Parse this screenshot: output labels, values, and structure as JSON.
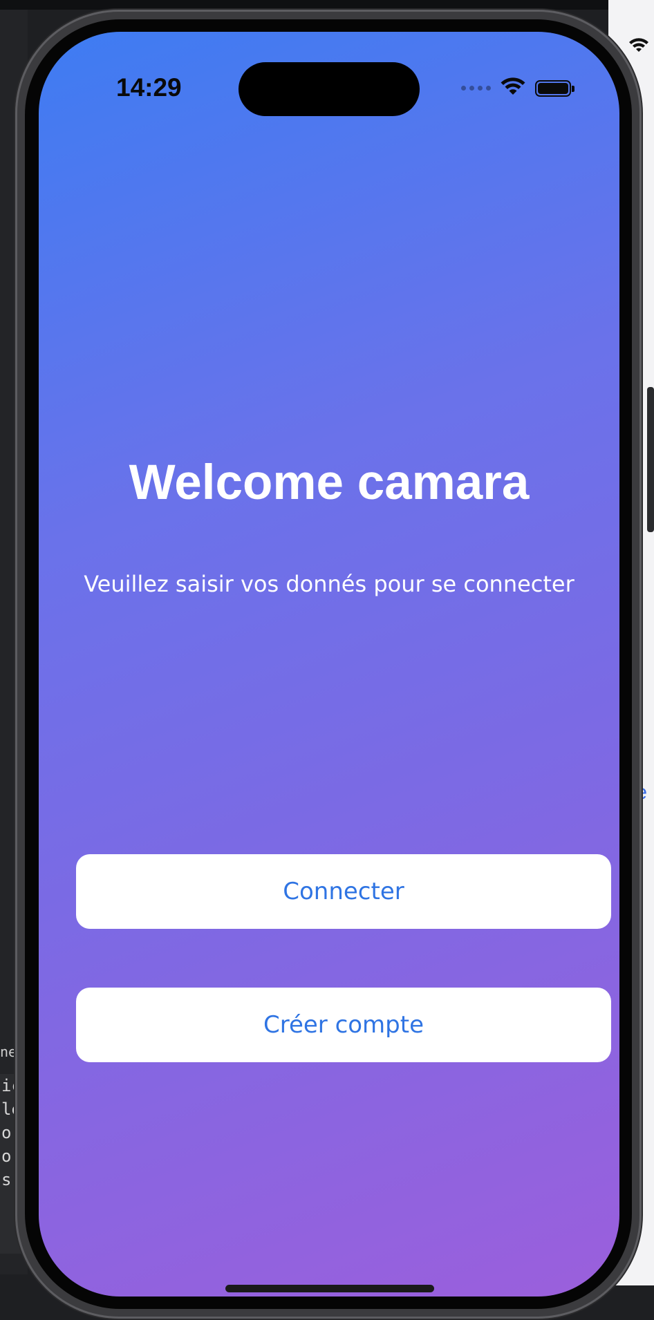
{
  "status_bar": {
    "time": "14:29"
  },
  "welcome": {
    "title": "Welcome camara",
    "subtitle": "Veuillez saisir vos donnés pour se connecter"
  },
  "buttons": {
    "connect_label": "Connecter",
    "create_label": "Créer compte"
  },
  "colors": {
    "gradient_start": "#3e7cf2",
    "gradient_end": "#9b5fdc",
    "button_text": "#2f74e3",
    "button_bg": "#ffffff"
  },
  "backdrop": {
    "code_lines": [
      "ic",
      "le",
      "or",
      "or",
      "s."
    ],
    "panel_tag": "ne",
    "right_pane_letter": "e"
  }
}
